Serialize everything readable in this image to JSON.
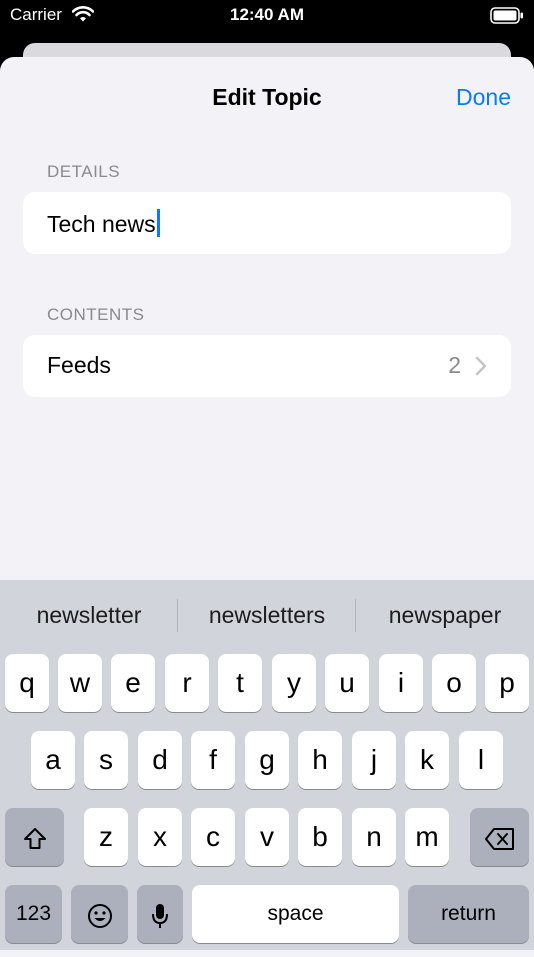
{
  "status_bar": {
    "carrier": "Carrier",
    "time": "12:40 AM"
  },
  "nav": {
    "title": "Edit Topic",
    "done_label": "Done"
  },
  "details": {
    "header": "DETAILS",
    "topic_name": "Tech news"
  },
  "contents": {
    "header": "CONTENTS",
    "feeds_label": "Feeds",
    "feeds_count": "2"
  },
  "keyboard": {
    "suggestions": [
      "newsletter",
      "newsletters",
      "newspaper"
    ],
    "row1": [
      "q",
      "w",
      "e",
      "r",
      "t",
      "y",
      "u",
      "i",
      "o",
      "p"
    ],
    "row2": [
      "a",
      "s",
      "d",
      "f",
      "g",
      "h",
      "j",
      "k",
      "l"
    ],
    "row3": [
      "z",
      "x",
      "c",
      "v",
      "b",
      "n",
      "m"
    ],
    "numbers_label": "123",
    "space_label": "space",
    "return_label": "return"
  },
  "colors": {
    "accent": "#0a7aff",
    "background": "#f2f2f7",
    "keyboard": "#d1d4da"
  }
}
